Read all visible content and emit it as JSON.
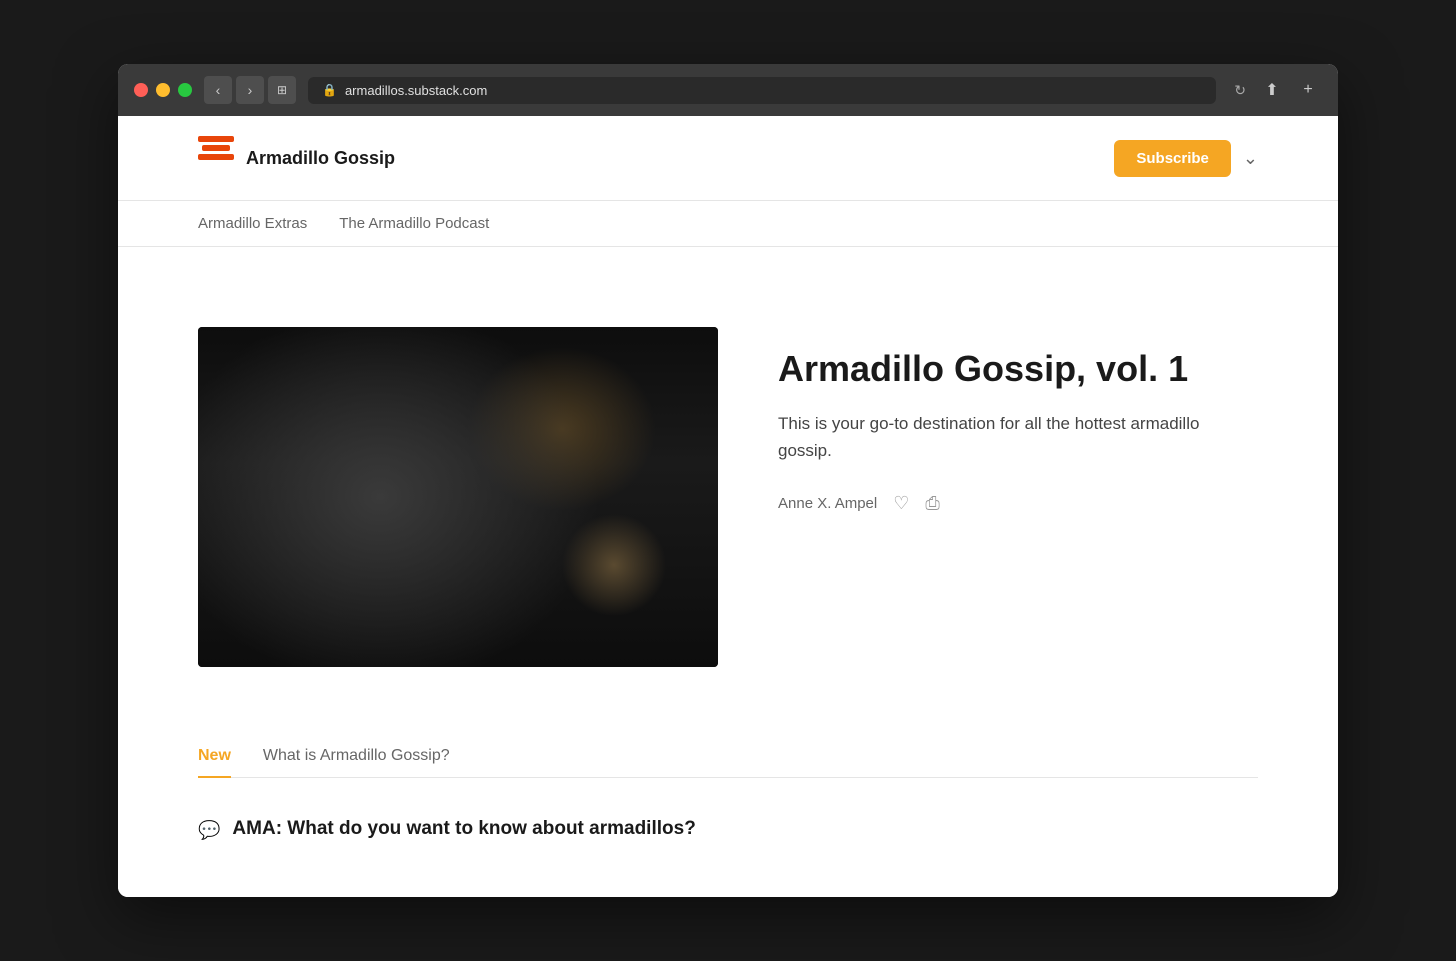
{
  "browser": {
    "url": "armadillos.substack.com",
    "back_label": "‹",
    "forward_label": "›",
    "tab_label": "⊞",
    "shield_icon": "🛡",
    "reload_icon": "↻",
    "share_icon": "⬆",
    "new_tab_icon": "+"
  },
  "header": {
    "brand_name": "Armadillo Gossip",
    "subscribe_label": "Subscribe",
    "chevron_label": "⌄"
  },
  "nav": {
    "items": [
      {
        "label": "Armadillo Extras",
        "active": false
      },
      {
        "label": "The Armadillo Podcast",
        "active": false
      }
    ]
  },
  "hero": {
    "title": "Armadillo Gossip, vol. 1",
    "description": "This is your go-to destination for all the hottest armadillo gossip.",
    "author": "Anne X. Ampel",
    "like_icon": "♡",
    "share_icon": "⎙"
  },
  "tabs": {
    "items": [
      {
        "label": "New",
        "active": true
      },
      {
        "label": "What is Armadillo Gossip?",
        "active": false
      }
    ]
  },
  "posts": [
    {
      "icon": "💬",
      "title": "AMA: What do you want to know about armadillos?"
    }
  ]
}
